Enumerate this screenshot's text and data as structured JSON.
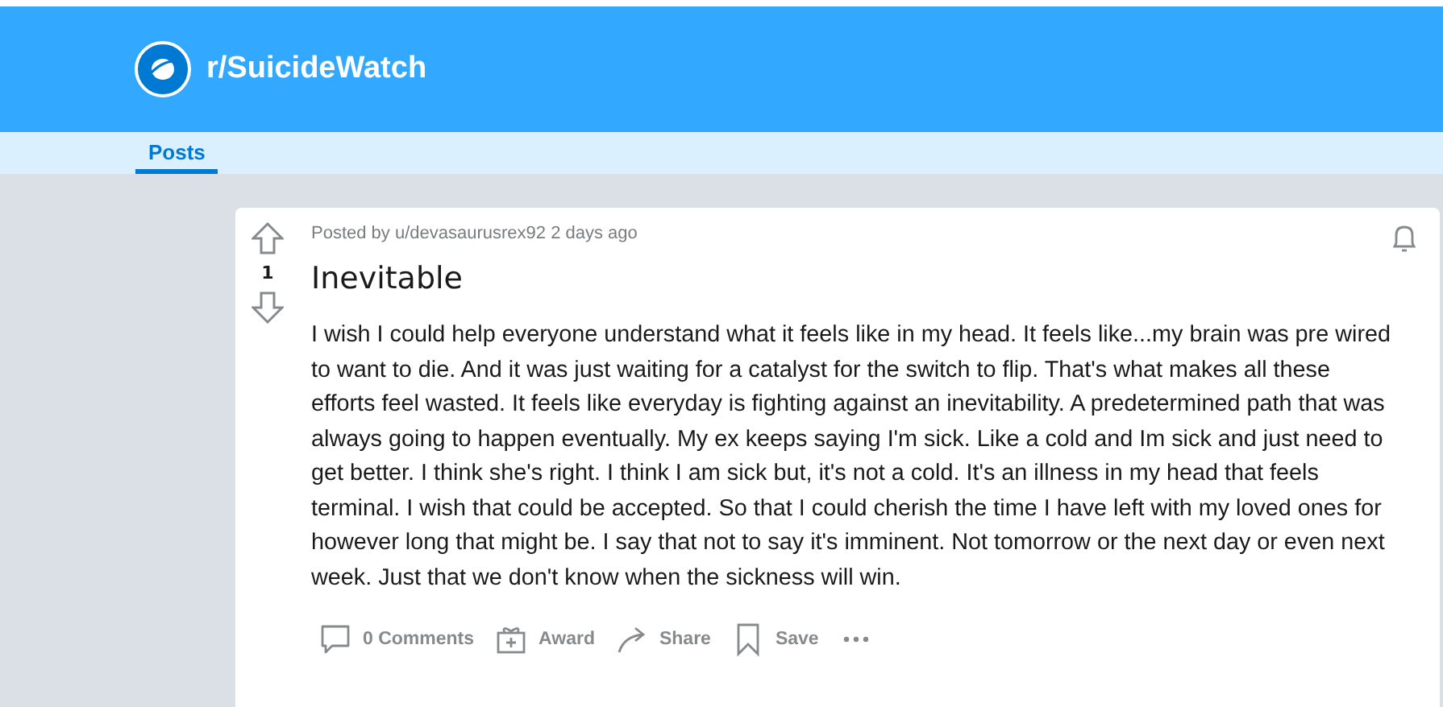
{
  "header": {
    "community": "r/SuicideWatch"
  },
  "tabs": [
    {
      "label": "Posts",
      "selected": true
    }
  ],
  "post": {
    "votes": "1",
    "meta": "Posted by u/devasaurusrex92 2 days ago",
    "title": "Inevitable",
    "body": "I wish I could help everyone understand what it feels like in my head. It feels like...my brain was pre wired to want to die. And it was just waiting for a catalyst for the switch to flip. That's what makes all these efforts feel wasted. It feels like everyday is fighting against an inevitability. A predetermined path that was always going to happen eventually. My ex keeps saying I'm sick. Like a cold and Im sick and just need to get better. I think she's right. I think I am sick but, it's not a cold. It's an illness in my head that feels terminal. I wish that could be accepted. So that I could cherish the time I have left with my loved ones for however long that might be. I say that not to say it's imminent. Not tomorrow or the next day or even next week. Just that we don't know when the sickness will win.",
    "actions": [
      {
        "kind": "comments",
        "label": "0 Comments"
      },
      {
        "kind": "award",
        "label": "Award"
      },
      {
        "kind": "share",
        "label": "Share"
      },
      {
        "kind": "save",
        "label": "Save"
      }
    ]
  }
}
